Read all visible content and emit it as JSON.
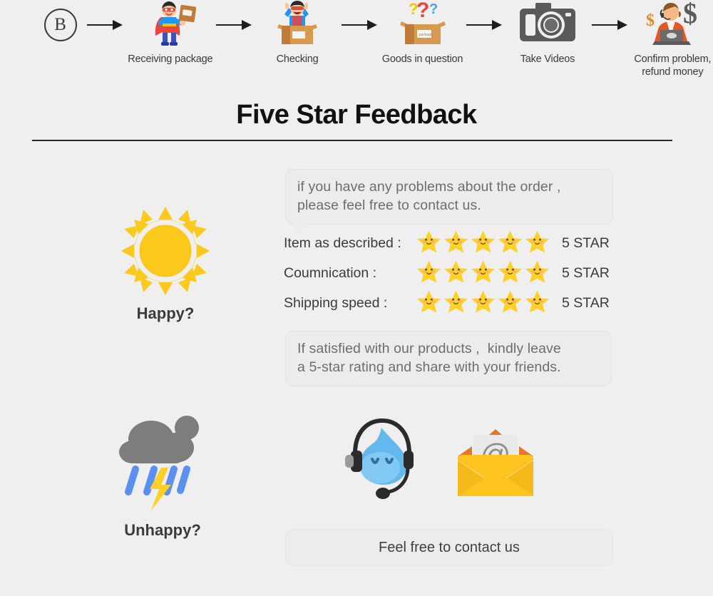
{
  "page": {
    "background_color": "#efefef"
  },
  "process_flow": {
    "badge_label": "B",
    "steps": [
      {
        "icon": "superhero-package-icon",
        "label": "Receiving package"
      },
      {
        "icon": "person-in-open-box-icon",
        "label": "Checking"
      },
      {
        "icon": "box-with-question-marks-icon",
        "label": "Goods in question"
      },
      {
        "icon": "camera-icon",
        "label": "Take Videos"
      },
      {
        "icon": "agent-laptop-dollar-icon",
        "label": "Confirm problem,\nrefund money"
      }
    ],
    "arrow_icon": "arrow-right-icon"
  },
  "heading": {
    "title": "Five Star Feedback",
    "rule_color": "#2a2a2a"
  },
  "happy_section": {
    "icon": "sun-icon",
    "icon_color": "#fbc91b",
    "label": "Happy?",
    "bubble_top": "if you have any problems about the order ,\nplease feel free to contact us.",
    "ratings": [
      {
        "label": "Item as described :",
        "stars": 5,
        "value": "5 STAR"
      },
      {
        "label": "Coumnication :",
        "stars": 5,
        "value": "5 STAR"
      },
      {
        "label": "Shipping speed :",
        "stars": 5,
        "value": "5 STAR"
      }
    ],
    "star_icon": "smiling-star-icon",
    "star_color": "#ffd028",
    "bubble_bottom": "If satisfied with our products ,  kindly leave\na 5-star rating and share with your friends."
  },
  "unhappy_section": {
    "icon": "rain-cloud-lightning-icon",
    "cloud_color": "#7d7d7d",
    "rain_color": "#5b8ff0",
    "bolt_color": "#ffd028",
    "label": "Unhappy?",
    "support_icons": [
      {
        "icon": "headset-chat-mascot-icon"
      },
      {
        "icon": "email-envelope-at-icon"
      }
    ],
    "contact_label": "Feel free to contact us"
  }
}
